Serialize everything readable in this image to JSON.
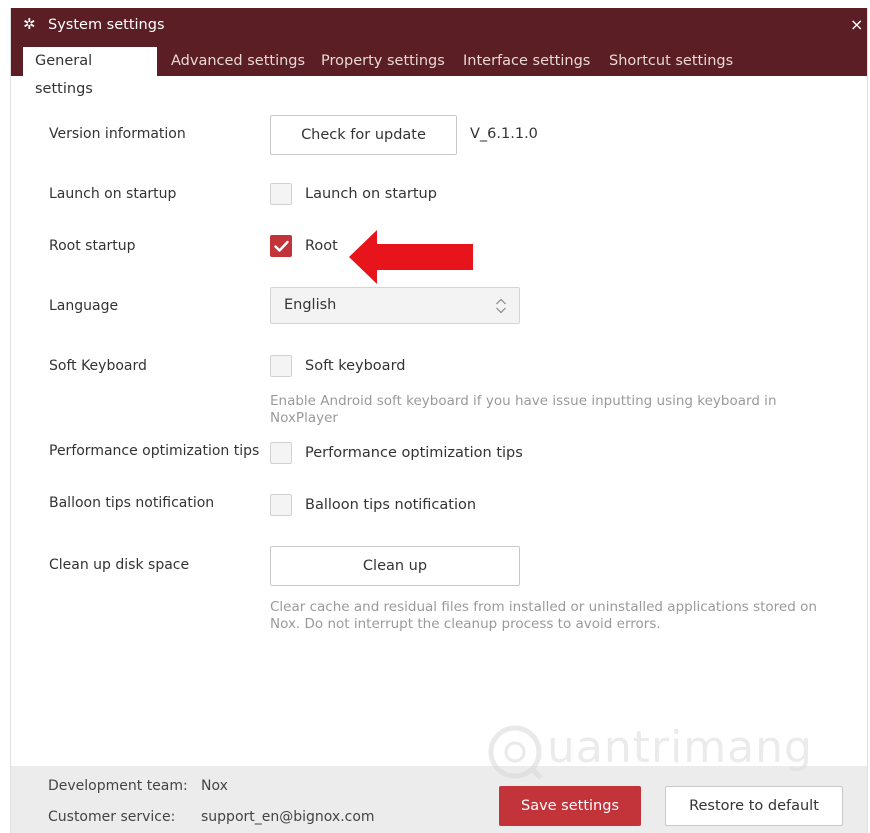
{
  "window": {
    "title": "System settings",
    "title_icon": "gear-icon",
    "close_icon": "close-icon",
    "close_glyph": "×"
  },
  "tabs": [
    {
      "label": "General settings",
      "active": true
    },
    {
      "label": "Advanced settings",
      "active": false
    },
    {
      "label": "Property settings",
      "active": false
    },
    {
      "label": "Interface settings",
      "active": false
    },
    {
      "label": "Shortcut settings",
      "active": false
    }
  ],
  "settings": {
    "version": {
      "label": "Version information",
      "button": "Check for update",
      "value": "V_6.1.1.0"
    },
    "launch_startup": {
      "label": "Launch on startup",
      "checkbox_label": "Launch on startup",
      "checked": false
    },
    "root_startup": {
      "label": "Root startup",
      "checkbox_label": "Root",
      "checked": true
    },
    "language": {
      "label": "Language",
      "selected": "English"
    },
    "soft_keyboard": {
      "label": "Soft Keyboard",
      "checkbox_label": "Soft keyboard",
      "checked": false,
      "hint": "Enable Android soft keyboard if you have issue inputting using keyboard in NoxPlayer"
    },
    "perf_tips": {
      "label": "Performance optimization tips",
      "checkbox_label": "Performance optimization tips",
      "checked": false
    },
    "balloon_tips": {
      "label": "Balloon tips notification",
      "checkbox_label": "Balloon tips notification",
      "checked": false
    },
    "cleanup": {
      "label": "Clean up disk space",
      "button": "Clean up",
      "hint": "Clear cache and residual files from installed or uninstalled applications stored on Nox. Do not interrupt the cleanup process to avoid errors."
    }
  },
  "footer": {
    "dev_team_label": "Development team:",
    "dev_team_value": "Nox",
    "customer_service_label": "Customer service:",
    "customer_service_value": "support_en@bignox.com",
    "save_button": "Save settings",
    "restore_button": "Restore to default"
  },
  "watermark": {
    "text": "uantrimang"
  },
  "colors": {
    "titlebar": "#5a1e24",
    "accent": "#c3333a",
    "annotation_arrow": "#e8141c"
  }
}
